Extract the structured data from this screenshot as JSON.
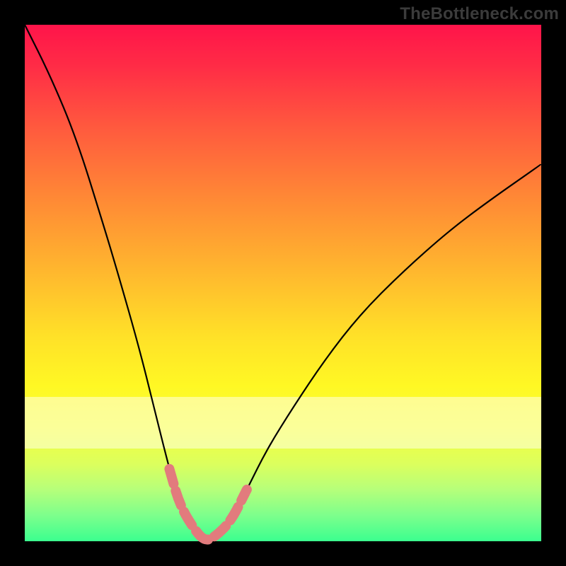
{
  "watermark": "TheBottleneck.com",
  "colors": {
    "frame_bg": "#000000",
    "watermark": "#3b3b3b",
    "curve_main": "#000000",
    "curve_accent": "#e27b7d",
    "gradient_top": "#ff144a",
    "gradient_bottom": "#3bff8f",
    "pale_band": "rgba(255,255,230,0.55)"
  },
  "chart_data": {
    "type": "line",
    "title": "",
    "xlabel": "",
    "ylabel": "",
    "xlim": [
      0,
      100
    ],
    "ylim": [
      0,
      100
    ],
    "notes": "V-shaped bottleneck curve. Y high = red (bad), Y low = green (good). Minimum at x≈35, y≈0. Thick pink overlay marks x≈27–45 region. Pale horizontal band spans approx y=18–28.",
    "pale_band_y": [
      18,
      28
    ],
    "accent_x_range": [
      27,
      45
    ],
    "series": [
      {
        "name": "bottleneck_curve",
        "x": [
          0,
          5,
          10,
          15,
          18,
          22,
          25,
          28,
          30,
          33,
          35,
          37,
          40,
          43,
          47,
          52,
          58,
          65,
          73,
          82,
          90,
          100
        ],
        "values": [
          100,
          90,
          78,
          62,
          52,
          38,
          26,
          14,
          7,
          2,
          0,
          1,
          4,
          10,
          18,
          26,
          35,
          44,
          52,
          60,
          66,
          73
        ]
      }
    ]
  }
}
